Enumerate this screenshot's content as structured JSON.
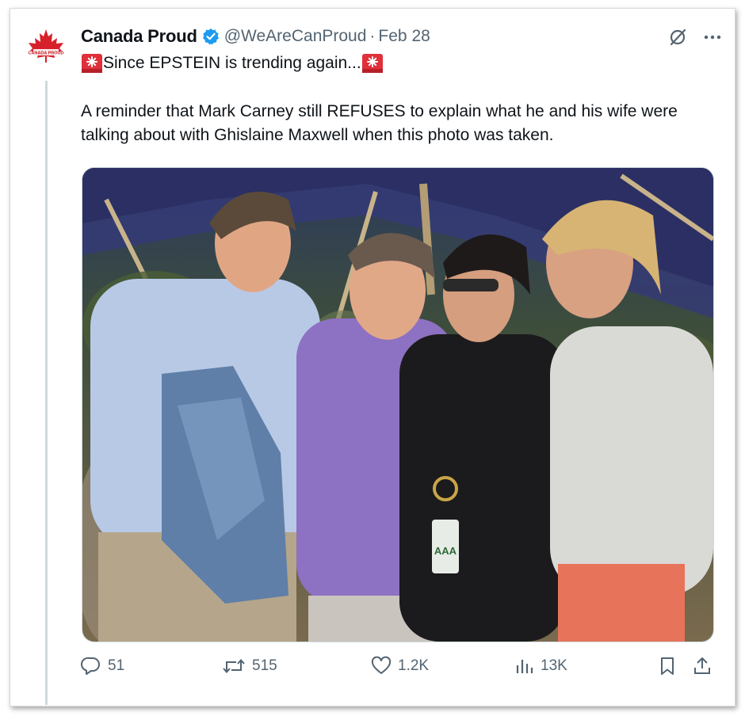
{
  "tweet": {
    "display_name": "Canada Proud",
    "handle": "@WeAreCanProud",
    "separator": "·",
    "date": "Feb 28",
    "headline": "Since EPSTEIN is trending again...",
    "body": "A reminder that Mark Carney still REFUSES to explain what he and his wife were talking about with Ghislaine Maxwell when this photo was taken.",
    "badge_text": "AAA",
    "avatar_text": "CANADA PROUD"
  },
  "actions": {
    "replies": "51",
    "reposts": "515",
    "likes": "1.2K",
    "views": "13K"
  },
  "icons": {
    "verified": "verified-badge-icon",
    "siren": "police-light-emoji-icon",
    "grok": "grok-icon",
    "more": "more-icon",
    "reply": "reply-icon",
    "repost": "repost-icon",
    "like": "heart-icon",
    "views": "views-icon",
    "bookmark": "bookmark-icon",
    "share": "share-icon"
  },
  "colors": {
    "verified_blue": "#1d9bf0",
    "secondary_text": "#536471",
    "brand_red": "#d6212a"
  }
}
